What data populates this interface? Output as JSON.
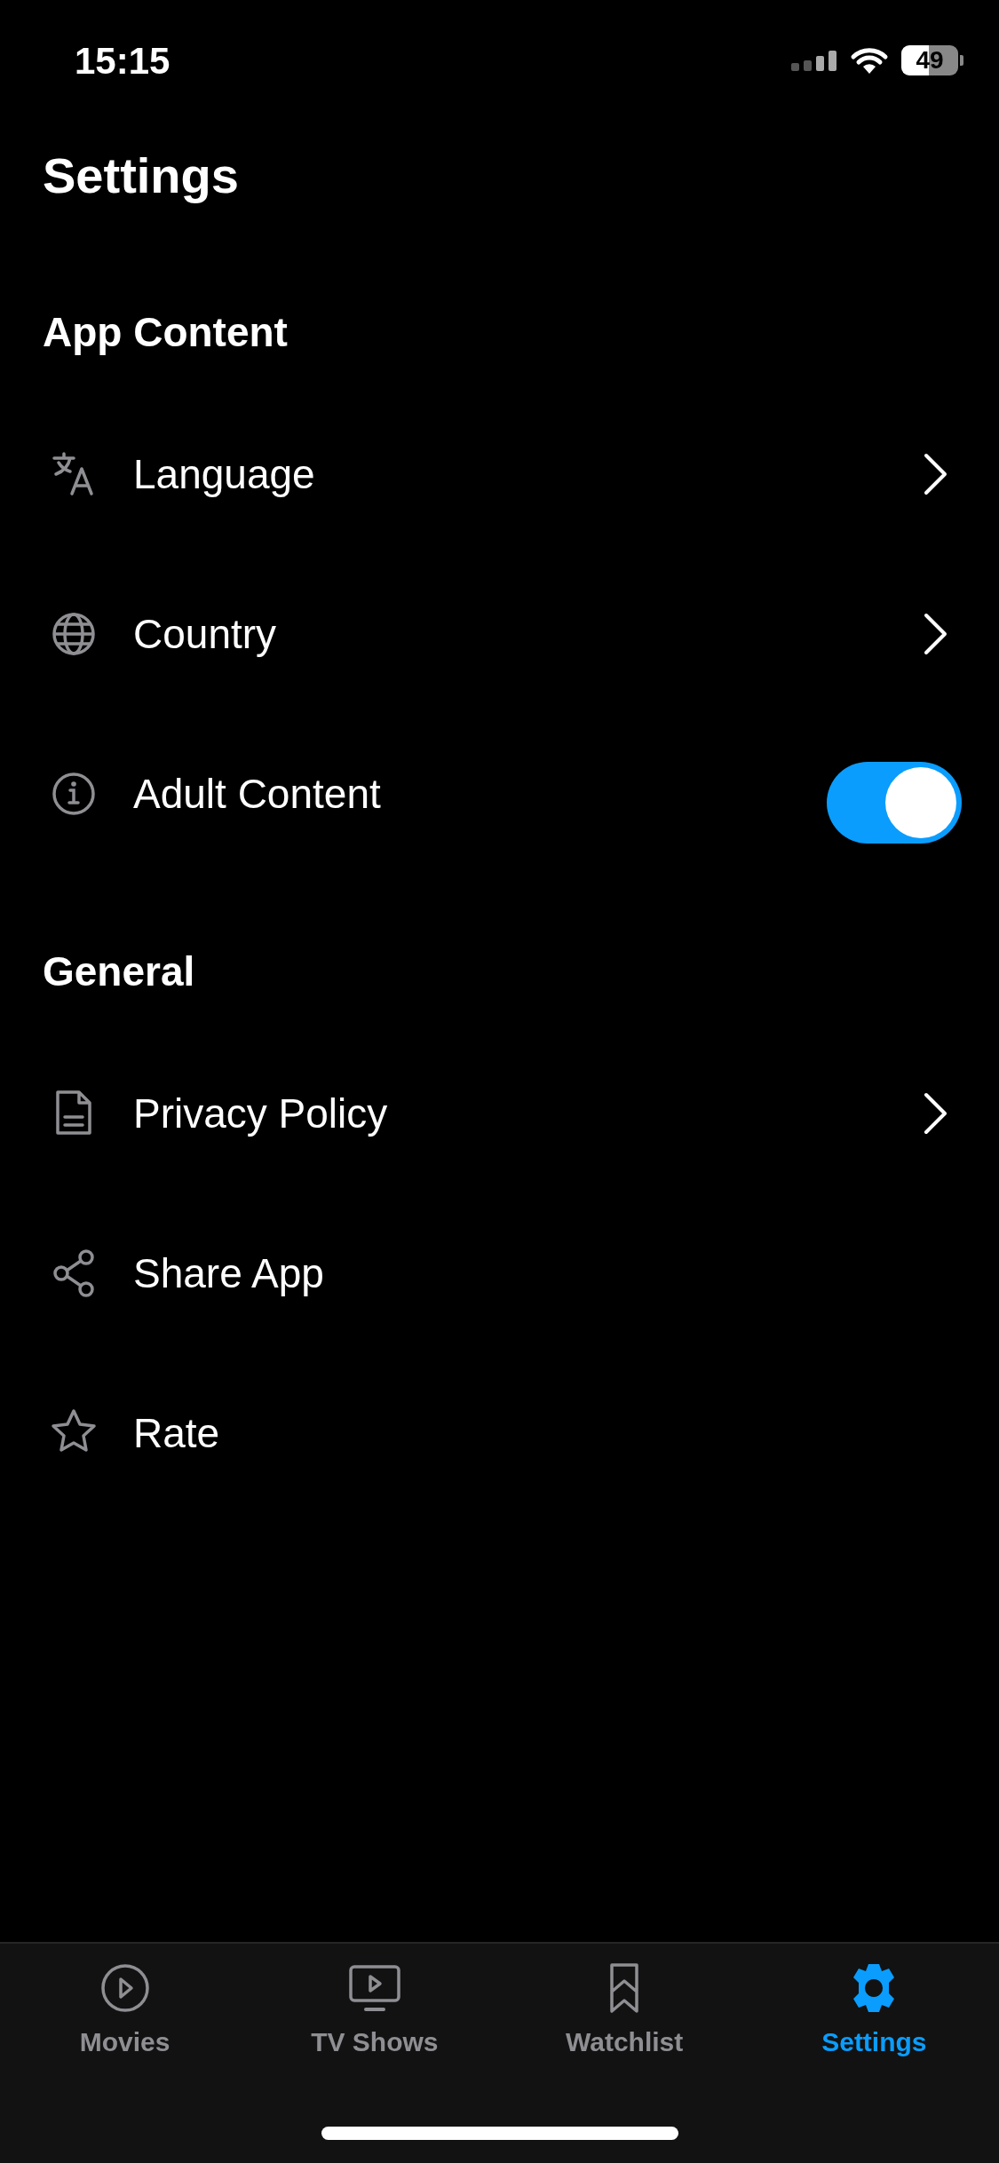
{
  "status_bar": {
    "time": "15:15",
    "battery": "49"
  },
  "title": "Settings",
  "sections": [
    {
      "heading": "App Content",
      "items": [
        {
          "label": "Language",
          "kind": "chevron"
        },
        {
          "label": "Country",
          "kind": "chevron"
        },
        {
          "label": "Adult Content",
          "kind": "toggle",
          "on": true
        }
      ]
    },
    {
      "heading": "General",
      "items": [
        {
          "label": "Privacy Policy",
          "kind": "chevron"
        },
        {
          "label": "Share App",
          "kind": "plain"
        },
        {
          "label": "Rate",
          "kind": "plain"
        }
      ]
    }
  ],
  "tab_bar": [
    {
      "label": "Movies",
      "selected": false
    },
    {
      "label": "TV Shows",
      "selected": false
    },
    {
      "label": "Watchlist",
      "selected": false
    },
    {
      "label": "Settings",
      "selected": true
    }
  ]
}
